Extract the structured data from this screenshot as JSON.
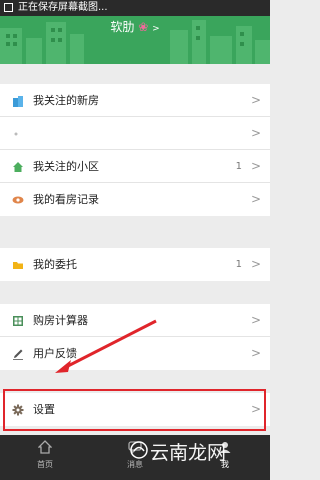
{
  "status_bar": {
    "notification_text": "正在保存屏幕截图..."
  },
  "header": {
    "user_name": "软肋",
    "flower_glyph": "❀",
    "chevron": ">"
  },
  "colors": {
    "header_green": "#3aa55c",
    "highlight_red": "#e0252b",
    "tabbar_bg": "#2b2b2b"
  },
  "group1": [
    {
      "label": "我关注的新房",
      "count": "",
      "icon": "building-icon"
    },
    {
      "label": "",
      "count": "",
      "icon": "dot-icon"
    },
    {
      "label": "我关注的小区",
      "count": "1",
      "icon": "house-icon"
    },
    {
      "label": "我的看房记录",
      "count": "",
      "icon": "eye-icon"
    }
  ],
  "group2": [
    {
      "label": "我的委托",
      "count": "1",
      "icon": "folder-icon"
    }
  ],
  "group3": [
    {
      "label": "购房计算器",
      "count": "",
      "icon": "calculator-icon"
    },
    {
      "label": "用户反馈",
      "count": "",
      "icon": "pencil-icon"
    }
  ],
  "group4": [
    {
      "label": "设置",
      "count": "",
      "icon": "gear-icon"
    }
  ],
  "arrow_glyph": ">",
  "tabs": [
    {
      "label": "首页",
      "icon": "home-icon"
    },
    {
      "label": "消息",
      "icon": "message-icon"
    },
    {
      "label": "我",
      "icon": "profile-icon"
    }
  ],
  "watermark": "云南龙网"
}
